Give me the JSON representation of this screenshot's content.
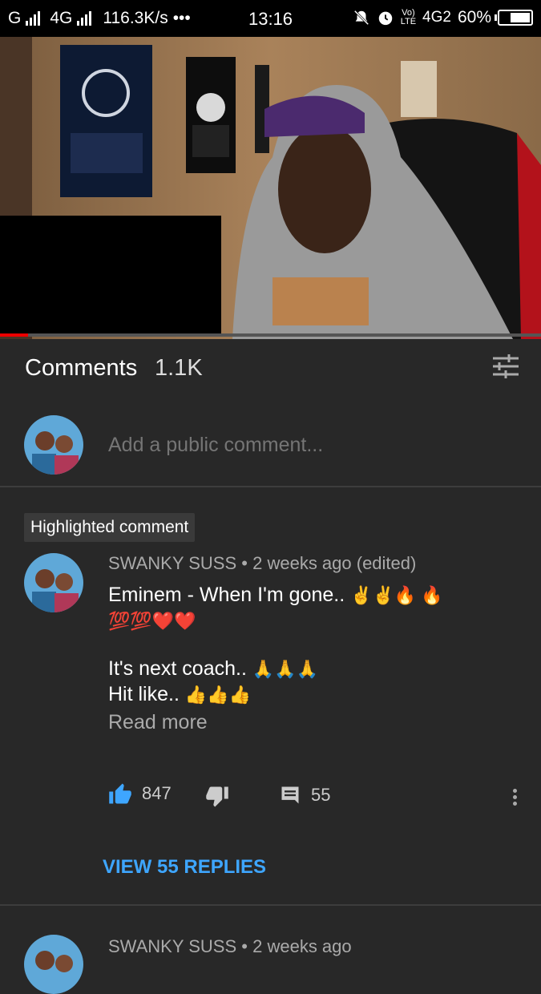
{
  "status_bar": {
    "carrier_left": "G",
    "network_type": "4G",
    "speed": "116.3K/s",
    "more": "•••",
    "time": "13:16",
    "volte": "Vo)",
    "lte": "LTE",
    "network_right": "4G2",
    "battery_text": "60%",
    "battery_level": 0.6
  },
  "comments": {
    "title": "Comments",
    "count": "1.1K",
    "add_placeholder": "Add a public comment..."
  },
  "highlighted_badge": "Highlighted comment",
  "comment1": {
    "author": "SWANKY SUSS",
    "separator": "•",
    "time": "2 weeks ago (edited)",
    "line1": "Eminem - When I'm gone..",
    "line1_emoji": "✌✌🔥 🔥",
    "line2_emoji": "💯💯❤️❤️",
    "line3": "It's next coach..",
    "line3_emoji": "🙏🙏🙏",
    "line4": "Hit like..",
    "line4_emoji": "👍👍👍",
    "read_more": "Read more",
    "likes": "847",
    "replies_count": "55",
    "view_replies": "VIEW 55 REPLIES"
  },
  "comment2": {
    "author": "SWANKY SUSS",
    "separator": "•",
    "time": "2 weeks ago"
  },
  "colors": {
    "background": "#282828",
    "link_blue": "#3ea6ff",
    "like_blue": "#3ea6ff"
  }
}
